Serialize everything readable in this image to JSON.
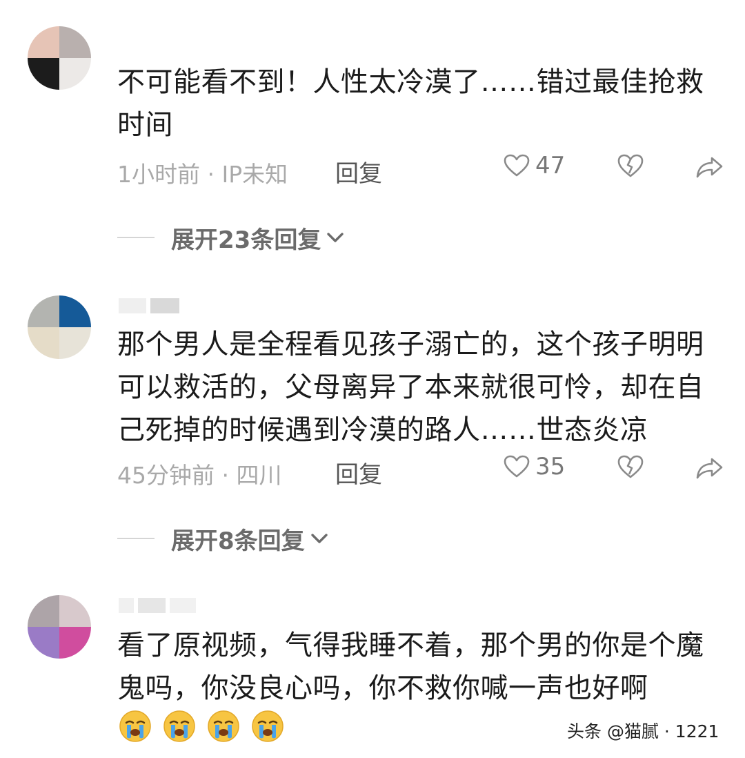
{
  "comments": [
    {
      "text": "不可能看不到！人性太冷漠了……错过最佳抢救时间",
      "time_location": "1小时前 · IP未知",
      "reply_label": "回复",
      "likes": "47",
      "expand_label": "展开23条回复"
    },
    {
      "text": "那个男人是全程看见孩子溺亡的，这个孩子明明可以救活的，父母离异了本来就很可怜，却在自己死掉的时候遇到冷漠的路人……世态炎凉",
      "time_location": "45分钟前 · 四川",
      "reply_label": "回复",
      "likes": "35",
      "expand_label": "展开8条回复"
    },
    {
      "text": "看了原视频，气得我睡不着，那个男的你是个魔鬼吗，你没良心吗，你不救你喊一声也好啊",
      "emoji_count": 4
    }
  ],
  "watermark": "头条 @猫腻 · 1221",
  "icons": {
    "like": "heart-outline-icon",
    "dislike": "broken-heart-icon",
    "share": "share-arrow-icon",
    "expand": "chevron-down-icon",
    "emoji": "crying-face-emoji"
  },
  "colors": {
    "text": "#1b1b1b",
    "meta": "#a9a9a9",
    "expand": "#6b6b6b",
    "emoji": "#f7c542",
    "tears": "#4aa3e8"
  }
}
